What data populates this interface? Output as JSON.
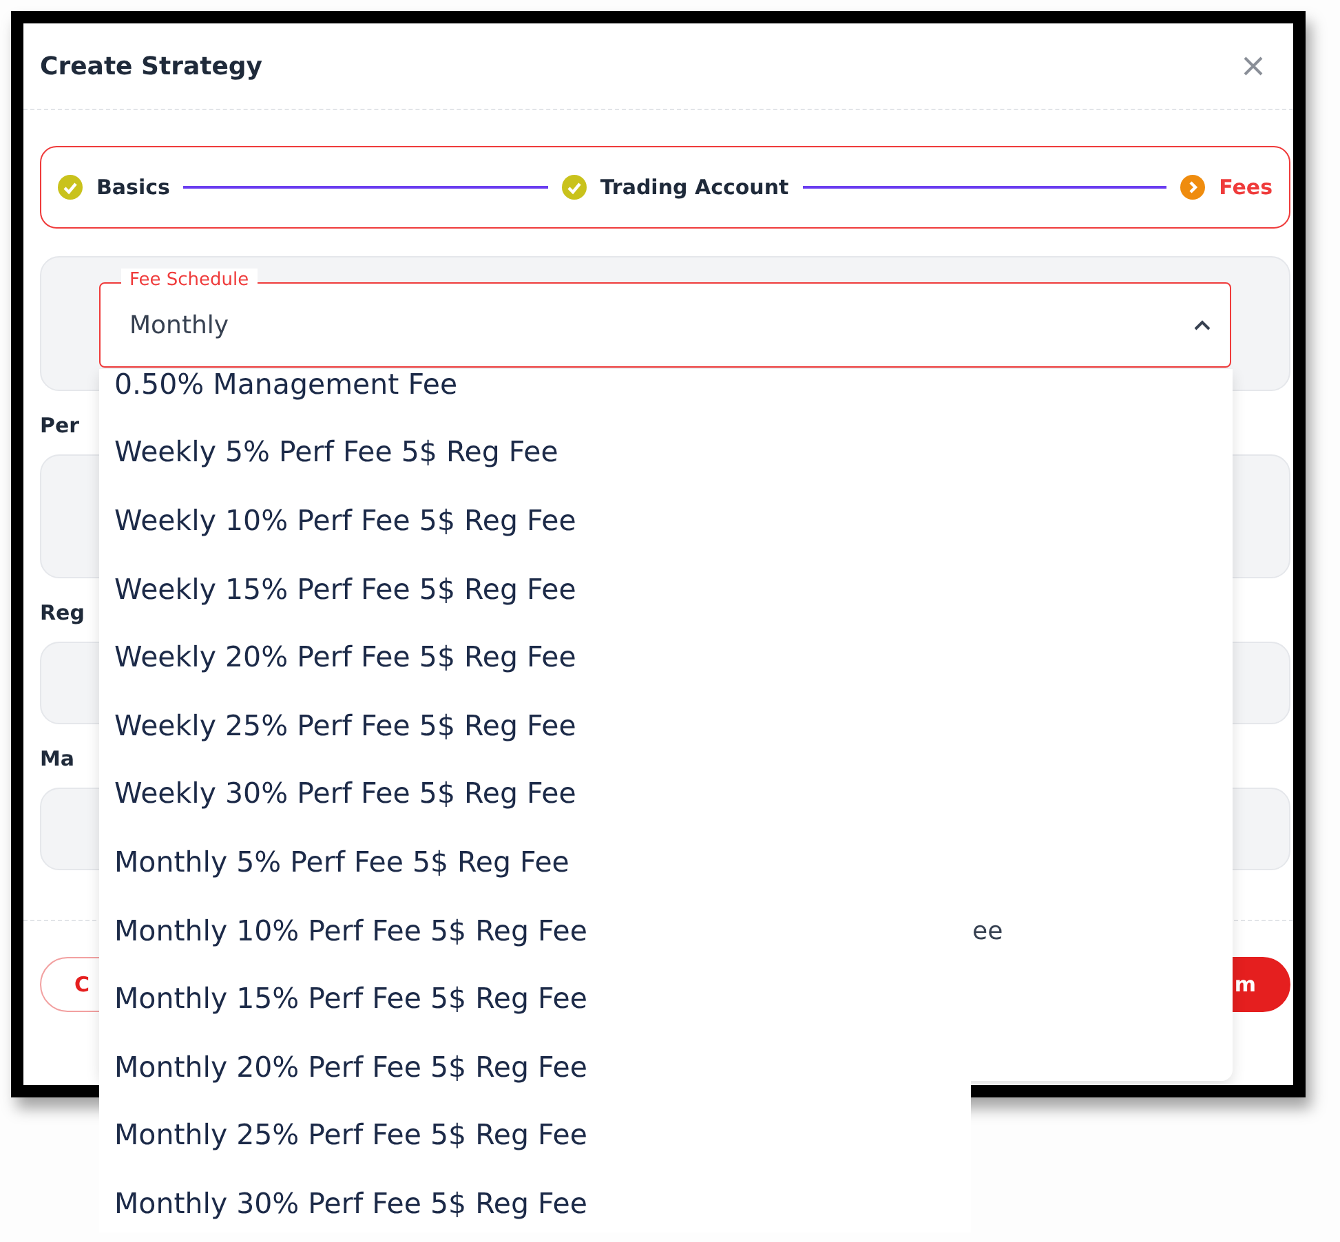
{
  "dialog": {
    "title": "Create Strategy"
  },
  "steps": [
    {
      "label": "Basics",
      "kind": "done"
    },
    {
      "label": "Trading Account",
      "kind": "done"
    },
    {
      "label": "Fees",
      "kind": "current"
    }
  ],
  "fee_schedule": {
    "label": "Fee Schedule",
    "value": "Monthly",
    "expanded": true,
    "options": [
      "0.50% Management Fee",
      "Weekly 5% Perf Fee 5$ Reg Fee",
      "Weekly 10% Perf Fee 5$ Reg Fee",
      "Weekly 15% Perf Fee 5$ Reg Fee",
      "Weekly 20% Perf Fee 5$ Reg Fee",
      "Weekly 25% Perf Fee 5$ Reg Fee",
      "Weekly 30% Perf Fee 5$ Reg Fee",
      "Monthly 5% Perf Fee 5$ Reg Fee",
      "Monthly 10% Perf Fee 5$ Reg Fee",
      "Monthly 15% Perf Fee 5$ Reg Fee",
      "Monthly 20% Perf Fee 5$ Reg Fee",
      "Monthly 25% Perf Fee 5$ Reg Fee",
      "Monthly 30% Perf Fee 5$ Reg Fee"
    ]
  },
  "fields": [
    {
      "label": "Per",
      "kind": "textarea"
    },
    {
      "label": "Reg",
      "kind": "input"
    },
    {
      "label": "Ma",
      "kind": "input"
    }
  ],
  "hidden_text": "ee",
  "buttons": [
    {
      "label": "C",
      "kind": "secondary"
    },
    {
      "label": "m",
      "kind": "primary"
    }
  ]
}
